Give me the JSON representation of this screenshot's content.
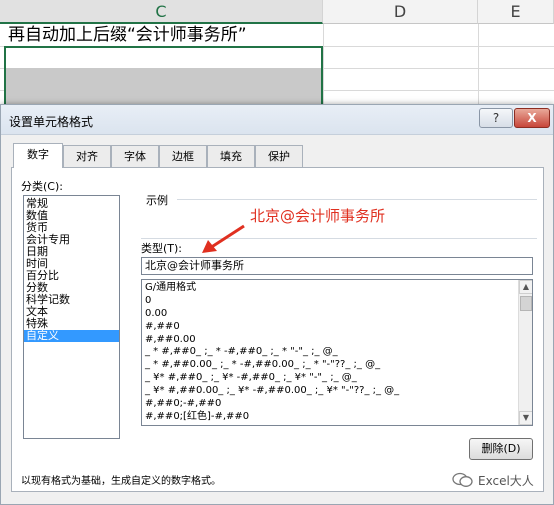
{
  "sheet": {
    "columns": [
      "C",
      "D",
      "E"
    ],
    "cell_text": "再自动加上后缀“会计师事务所”"
  },
  "dialog": {
    "title": "设置单元格格式",
    "help_button": "?",
    "close_button": "X",
    "tabs": [
      {
        "label": "数字"
      },
      {
        "label": "对齐"
      },
      {
        "label": "字体"
      },
      {
        "label": "边框"
      },
      {
        "label": "填充"
      },
      {
        "label": "保护"
      }
    ],
    "category_label": "分类(C):",
    "categories": [
      "常规",
      "数值",
      "货币",
      "会计专用",
      "日期",
      "时间",
      "百分比",
      "分数",
      "科学记数",
      "文本",
      "特殊",
      "自定义"
    ],
    "selected_category": "自定义",
    "sample_label": "示例",
    "sample_value": "北京@会计师事务所",
    "type_label": "类型(T):",
    "type_value": "北京@会计师事务所",
    "formats": [
      "G/通用格式",
      "0",
      "0.00",
      "#,##0",
      "#,##0.00",
      "_ * #,##0_ ;_ * -#,##0_ ;_ * \"-\"_ ;_ @_",
      "_ * #,##0.00_ ;_ * -#,##0.00_ ;_ * \"-\"??_ ;_ @_",
      "_ ¥* #,##0_ ;_ ¥* -#,##0_ ;_ ¥* \"-\"_ ;_ @_",
      "_ ¥* #,##0.00_ ;_ ¥* -#,##0.00_ ;_ ¥* \"-\"??_ ;_ @_",
      "#,##0;-#,##0",
      "#,##0;[红色]-#,##0"
    ],
    "delete_button": "删除(D)",
    "description": "以现有格式为基础，生成自定义的数字格式。"
  },
  "annotation": {
    "text": "北京@会计师事务所",
    "color": "#e03020"
  },
  "watermark": {
    "text": "Excel大人"
  },
  "colors": {
    "selected_tab_accent": "#217346",
    "selection_blue": "#3399ff"
  }
}
